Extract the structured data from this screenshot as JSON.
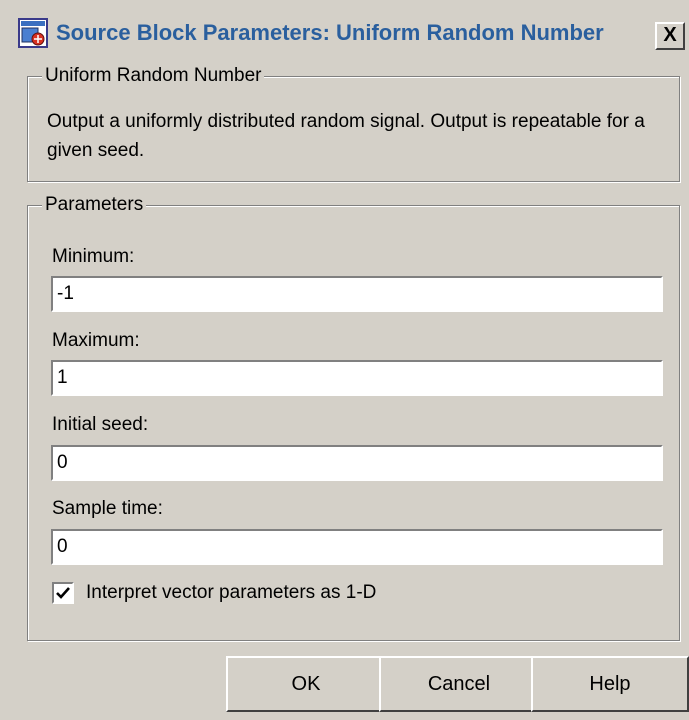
{
  "window": {
    "title": "Source Block Parameters: Uniform Random Number",
    "close_label": "X"
  },
  "description_group": {
    "legend": "Uniform Random Number",
    "text": "Output a uniformly distributed random signal.  Output is repeatable for a given seed."
  },
  "parameters_group": {
    "legend": "Parameters",
    "fields": [
      {
        "label": "Minimum:",
        "value": "-1"
      },
      {
        "label": "Maximum:",
        "value": "1"
      },
      {
        "label": "Initial seed:",
        "value": "0"
      },
      {
        "label": "Sample time:",
        "value": "0"
      }
    ],
    "checkbox": {
      "label": "Interpret vector parameters as 1-D",
      "checked": true
    }
  },
  "buttons": {
    "ok": "OK",
    "cancel": "Cancel",
    "help": "Help"
  },
  "icons": {
    "app": "simulink-block-icon",
    "close": "close-icon",
    "check": "checkmark-icon"
  }
}
